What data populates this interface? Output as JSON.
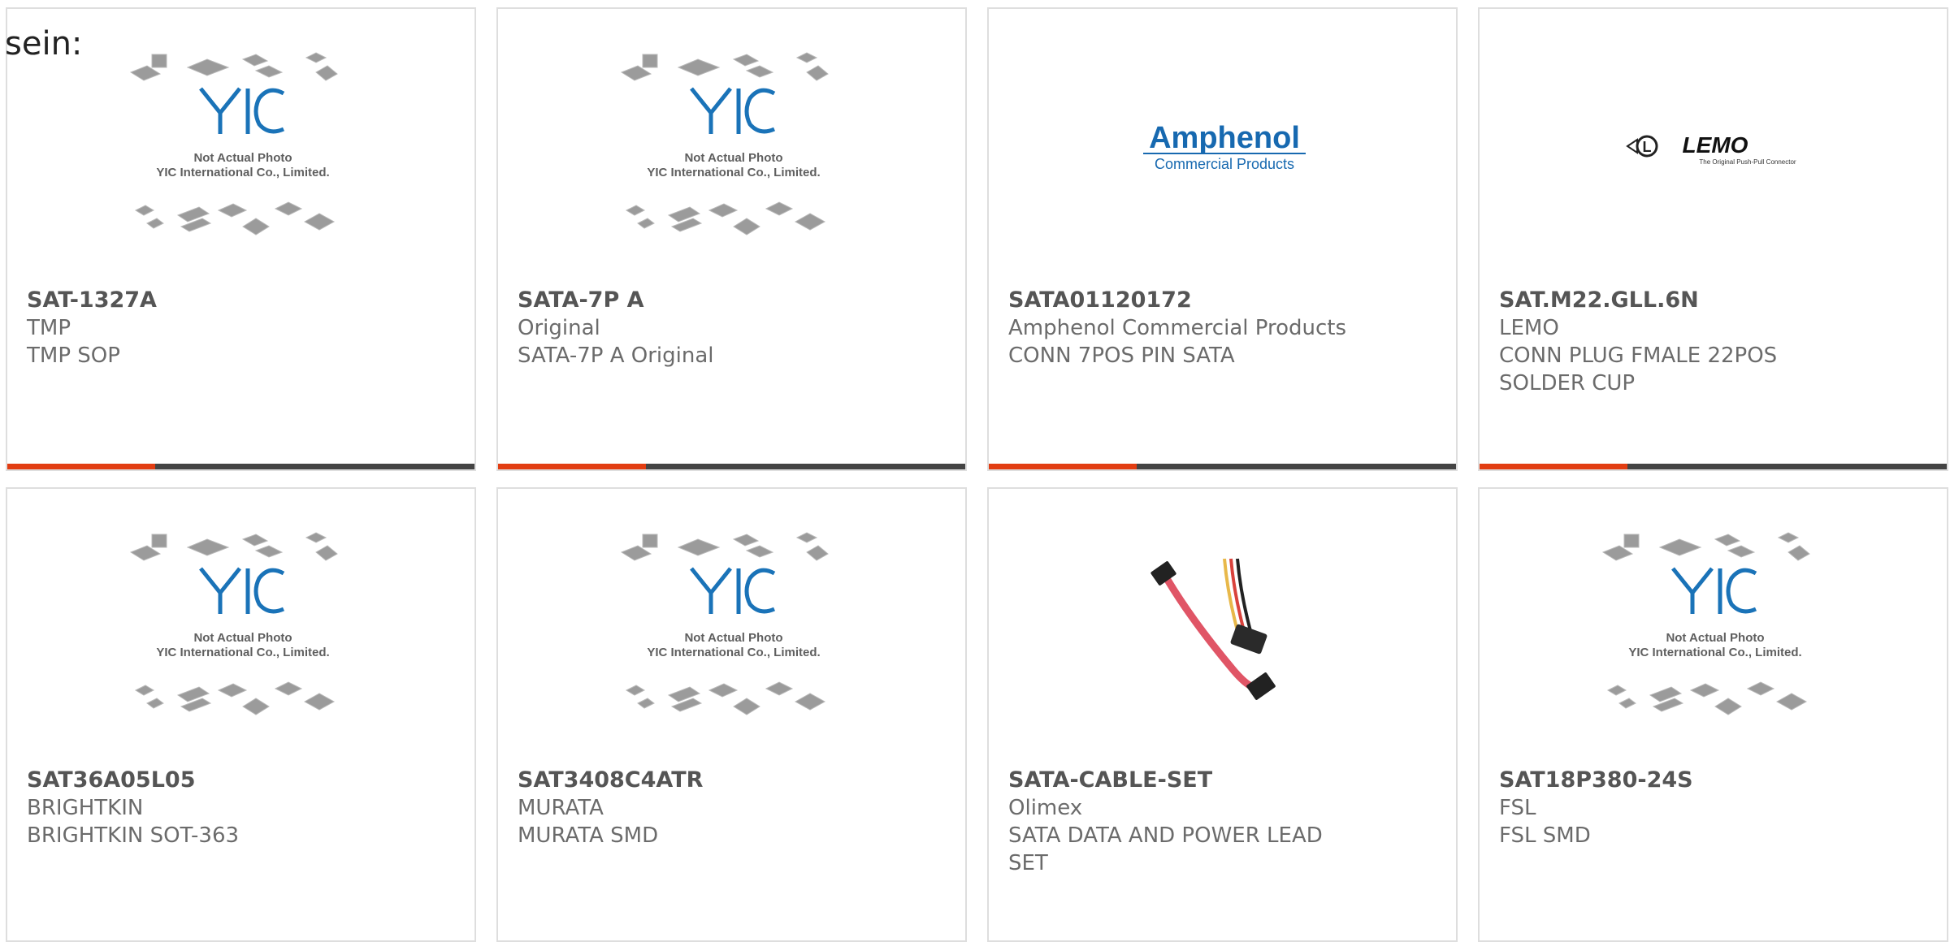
{
  "lead_text": "sein:",
  "placeholder": {
    "line1": "Not Actual Photo",
    "line2": "YIC International Co., Limited."
  },
  "logos": {
    "amphenol_name": "Amphenol",
    "amphenol_sub": "Commercial Products",
    "lemo_name": "LEMO",
    "lemo_tagline": "The Original Push-Pull Connector"
  },
  "colors": {
    "accent_red": "#e23d12",
    "bar_dark": "#444444",
    "yic_blue": "#1a73b8",
    "amphenol_blue": "#1769b0"
  },
  "products": [
    {
      "part": "SAT-1327A",
      "mfr": "TMP",
      "desc": "TMP SOP",
      "image": "yic-placeholder"
    },
    {
      "part": "SATA-7P A",
      "mfr": "Original",
      "desc": "SATA-7P A Original",
      "image": "yic-placeholder"
    },
    {
      "part": "SATA01120172",
      "mfr": "Amphenol Commercial Products",
      "desc": "CONN 7POS PIN SATA",
      "image": "amphenol-logo"
    },
    {
      "part": "SAT.M22.GLL.6N",
      "mfr": "LEMO",
      "desc": "CONN PLUG FMALE 22POS\nSOLDER CUP",
      "image": "lemo-logo"
    },
    {
      "part": "SAT36A05L05",
      "mfr": "BRIGHTKIN",
      "desc": "BRIGHTKIN SOT-363",
      "image": "yic-placeholder"
    },
    {
      "part": "SAT3408C4ATR",
      "mfr": "MURATA",
      "desc": "MURATA SMD",
      "image": "yic-placeholder"
    },
    {
      "part": "SATA-CABLE-SET",
      "mfr": "Olimex",
      "desc": "SATA DATA AND POWER LEAD\nSET",
      "image": "sata-cable-photo"
    },
    {
      "part": "SAT18P380-24S",
      "mfr": "FSL",
      "desc": "FSL SMD",
      "image": "yic-placeholder"
    }
  ]
}
